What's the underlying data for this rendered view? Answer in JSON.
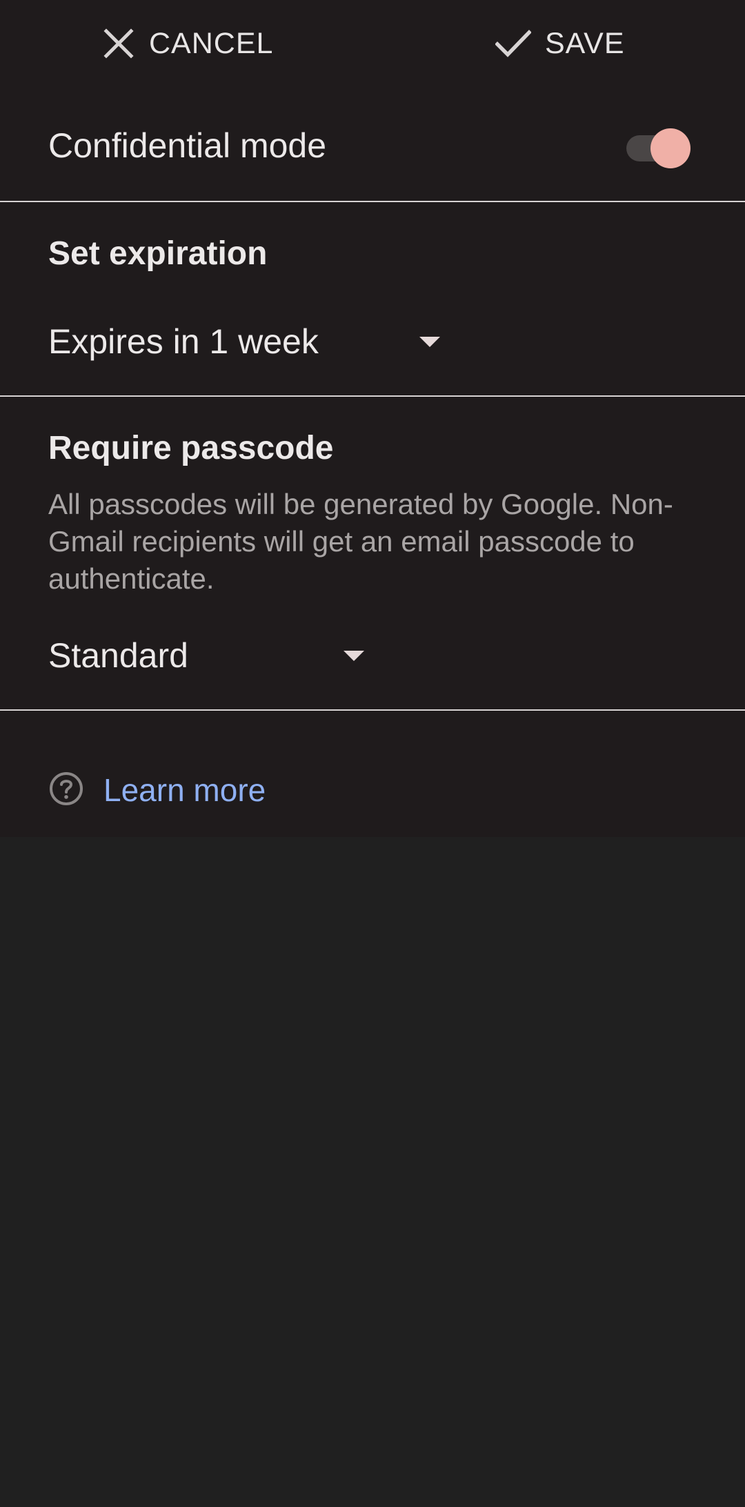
{
  "actions": {
    "cancel_label": "CANCEL",
    "save_label": "SAVE"
  },
  "confidential": {
    "label": "Confidential mode",
    "toggle_on": true
  },
  "expiration": {
    "title": "Set expiration",
    "selected": "Expires in 1 week"
  },
  "passcode": {
    "title": "Require passcode",
    "description": "All passcodes will be generated by Google. Non-Gmail recipients will get an email passcode to authenticate.",
    "selected": "Standard"
  },
  "help": {
    "link_label": "Learn more"
  },
  "colors": {
    "toggle_knob": "#f0b0a7",
    "link": "#8fb0f2",
    "sheet_bg": "#1f1b1c",
    "page_bg": "#202020"
  },
  "icons": [
    "close-icon",
    "check-icon",
    "dropdown-caret-icon",
    "help-circle-icon"
  ]
}
